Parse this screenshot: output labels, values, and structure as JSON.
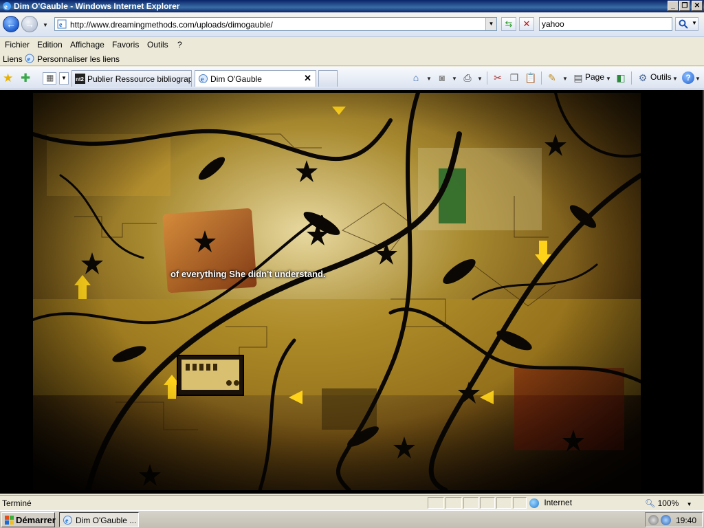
{
  "window": {
    "title": "Dim O'Gauble - Windows Internet Explorer",
    "minimize": "_",
    "restore": "❐",
    "close": "✕"
  },
  "address": {
    "url": "http://www.dreamingmethods.com/uploads/dimogauble/",
    "search_value": "yahoo"
  },
  "menu": {
    "items": [
      "Fichier",
      "Edition",
      "Affichage",
      "Favoris",
      "Outils",
      "?"
    ]
  },
  "links": {
    "label": "Liens",
    "custom": "Personnaliser les liens"
  },
  "tabs": [
    {
      "label": "Publier Ressource bibliograp...",
      "icon": "nt2-icon"
    },
    {
      "label": "Dim O'Gauble",
      "icon": "ie-page-icon"
    }
  ],
  "commands": {
    "page": "Page",
    "tools": "Outils",
    "help": "?"
  },
  "content": {
    "caption": "of everything She didn't understand."
  },
  "status": {
    "text": "Terminé",
    "zone": "Internet",
    "zoom": "100%"
  },
  "taskbar": {
    "start": "Démarrer",
    "task": "Dim O'Gauble ...",
    "clock": "19:40"
  },
  "colors": {
    "titlebar": "#0a246a",
    "chrome": "#ece9d8",
    "artwork_base": "#8a6a1e"
  }
}
